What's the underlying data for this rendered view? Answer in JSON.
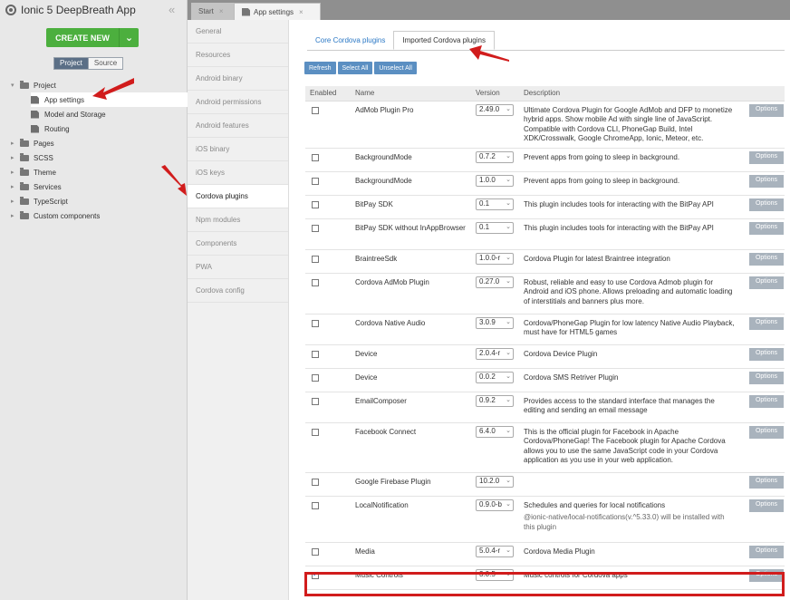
{
  "app": {
    "title": "Ionic 5 DeepBreath App",
    "collapse_glyph": "«"
  },
  "sidebar": {
    "create_label": "CREATE NEW",
    "create_dropdown": "⌄",
    "view_tabs": [
      "Project",
      "Source"
    ],
    "tree": [
      {
        "label": "Project",
        "indent": 0,
        "type": "folder"
      },
      {
        "label": "App settings",
        "indent": 1,
        "type": "page"
      },
      {
        "label": "Model and Storage",
        "indent": 1,
        "type": "page"
      },
      {
        "label": "Routing",
        "indent": 1,
        "type": "page"
      },
      {
        "label": "Pages",
        "indent": 0,
        "type": "folder"
      },
      {
        "label": "SCSS",
        "indent": 0,
        "type": "folder"
      },
      {
        "label": "Theme",
        "indent": 0,
        "type": "folder"
      },
      {
        "label": "Services",
        "indent": 0,
        "type": "folder"
      },
      {
        "label": "TypeScript",
        "indent": 0,
        "type": "folder"
      },
      {
        "label": "Custom components",
        "indent": 0,
        "type": "folder"
      }
    ]
  },
  "tabs": {
    "start": "Start",
    "app_settings": "App settings",
    "close": "×"
  },
  "settings_nav": [
    "General",
    "Resources",
    "Android binary",
    "Android permissions",
    "Android features",
    "iOS binary",
    "iOS keys",
    "Cordova plugins",
    "Npm modules",
    "Components",
    "PWA",
    "Cordova config"
  ],
  "main": {
    "subtabs": [
      "Core Cordova plugins",
      "Imported Cordova plugins"
    ],
    "buttons": {
      "refresh": "Refresh",
      "select_all": "Select All",
      "unselect_all": "Unselect All"
    },
    "columns": [
      "Enabled",
      "Name",
      "Version",
      "Description",
      ""
    ],
    "options_label": "Options",
    "plugins": [
      {
        "enabled": false,
        "name": "AdMob Plugin Pro",
        "version": "2.49.0",
        "description": "Ultimate Cordova Plugin for Google AdMob and DFP to monetize hybrid apps. Show mobile Ad with single line of JavaScript. Compatible with Cordova CLI, PhoneGap Build, Intel XDK/Crosswalk, Google ChromeApp, Ionic, Meteor, etc."
      },
      {
        "enabled": false,
        "name": "BackgroundMode",
        "version": "0.7.2",
        "description": "Prevent apps from going to sleep in background."
      },
      {
        "enabled": false,
        "name": "BackgroundMode",
        "version": "1.0.0",
        "description": "Prevent apps from going to sleep in background."
      },
      {
        "enabled": false,
        "name": "BitPay SDK",
        "version": "0.1",
        "description": "This plugin includes tools for interacting with the BitPay API"
      },
      {
        "enabled": false,
        "name": "BitPay SDK without InAppBrowser",
        "version": "0.1",
        "description": "This plugin includes tools for interacting with the BitPay API"
      },
      {
        "enabled": false,
        "name": "BraintreeSdk",
        "version": "1.0.0-r",
        "description": "Cordova Plugin for latest Braintree integration"
      },
      {
        "enabled": false,
        "name": "Cordova AdMob Plugin",
        "version": "0.27.0",
        "description": "Robust, reliable and easy to use Cordova Admob plugin for Android and iOS phone. Allows preloading and automatic loading of interstitials and banners plus more."
      },
      {
        "enabled": false,
        "name": "Cordova Native Audio",
        "version": "3.0.9",
        "description": "Cordova/PhoneGap Plugin for low latency Native Audio Playback, must have for HTML5 games"
      },
      {
        "enabled": false,
        "name": "Device",
        "version": "2.0.4-r",
        "description": "Cordova Device Plugin"
      },
      {
        "enabled": false,
        "name": "Device",
        "version": "0.0.2",
        "description": "Cordova SMS Retriver Plugin"
      },
      {
        "enabled": false,
        "name": "EmailComposer",
        "version": "0.9.2",
        "description": "Provides access to the standard interface that manages the editing and sending an email message"
      },
      {
        "enabled": false,
        "name": "Facebook Connect",
        "version": "6.4.0",
        "description": "This is the official plugin for Facebook in Apache Cordova/PhoneGap! The Facebook plugin for Apache Cordova allows you to use the same JavaScript code in your Cordova application as you use in your web application."
      },
      {
        "enabled": false,
        "name": "Google Firebase Plugin",
        "version": "10.2.0",
        "description": ""
      },
      {
        "enabled": false,
        "name": "LocalNotification",
        "version": "0.9.0-b",
        "description": "Schedules and queries for local notifications",
        "note": "@ionic-native/local-notifications(v.^5.33.0) will be installed with this plugin"
      },
      {
        "enabled": false,
        "name": "Media",
        "version": "5.0.4-r",
        "description": "Cordova Media Plugin"
      },
      {
        "enabled": true,
        "name": "Music Controls",
        "version": "3.0.5",
        "description": "Music controls for Cordova apps"
      }
    ]
  },
  "colors": {
    "accent": "#4caf3e",
    "highlight": "#d11c1c",
    "options": "#a9b3bd",
    "action": "#5b8fc2"
  }
}
